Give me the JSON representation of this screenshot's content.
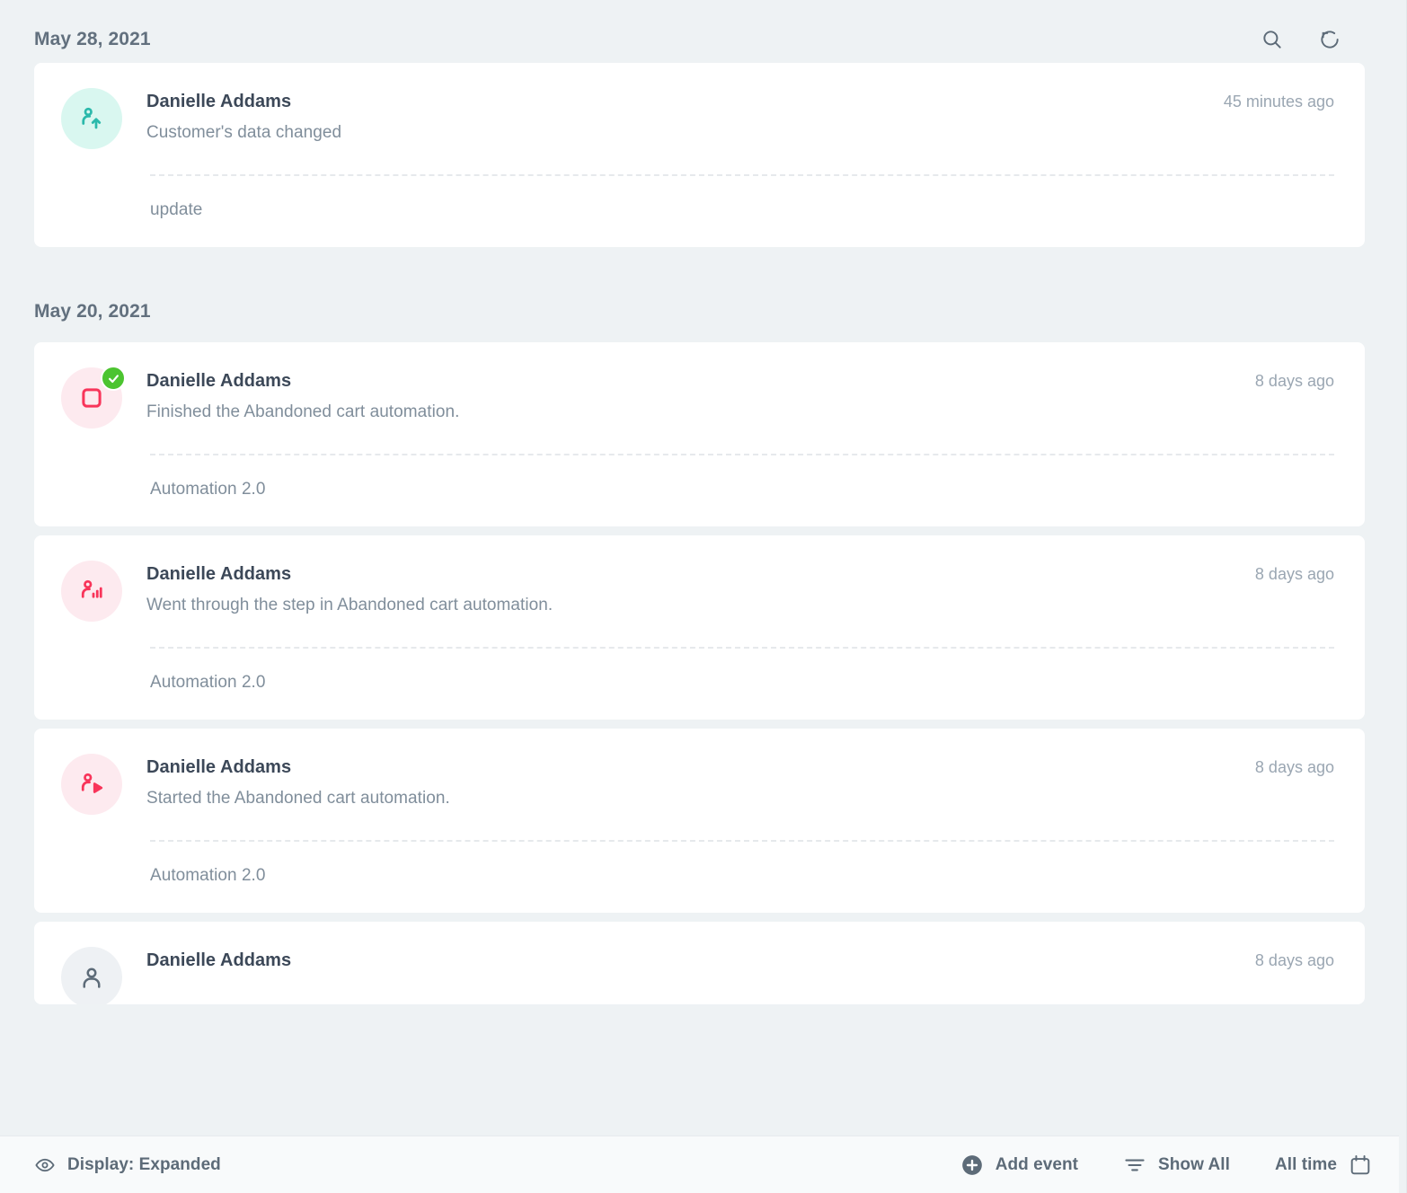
{
  "header": {
    "tools": [
      {
        "name": "search-icon",
        "label": "Search"
      },
      {
        "name": "refresh-icon",
        "label": "Refresh"
      }
    ]
  },
  "groups": [
    {
      "date": "May 28, 2021",
      "events": [
        {
          "name": "Danielle Addams",
          "description": "Customer's data changed",
          "time": "45 minutes ago",
          "detail": "update",
          "icon": "person-upload-icon",
          "avatar_bg": "teal",
          "icon_color": "#2bb9ab",
          "badge": false
        }
      ]
    },
    {
      "date": "May 20, 2021",
      "events": [
        {
          "name": "Danielle Addams",
          "description": "Finished the Abandoned cart automation.",
          "time": "8 days ago",
          "detail": "Automation 2.0",
          "icon": "stop-square-icon",
          "avatar_bg": "pink",
          "icon_color": "#f8355a",
          "badge": true,
          "badge_color": "#4cc430"
        },
        {
          "name": "Danielle Addams",
          "description": "Went through the step in Abandoned cart automation.",
          "time": "8 days ago",
          "detail": "Automation 2.0",
          "icon": "person-chart-icon",
          "avatar_bg": "pink",
          "icon_color": "#f8355a",
          "badge": false
        },
        {
          "name": "Danielle Addams",
          "description": "Started the Abandoned cart automation.",
          "time": "8 days ago",
          "detail": "Automation 2.0",
          "icon": "person-play-icon",
          "avatar_bg": "pink",
          "icon_color": "#f8355a",
          "badge": false
        },
        {
          "name": "Danielle Addams",
          "description": "",
          "time": "8 days ago",
          "detail": "",
          "icon": "person-icon",
          "avatar_bg": "gray",
          "icon_color": "#5d6b78",
          "badge": false,
          "clipped": true
        }
      ]
    }
  ],
  "toolbar": {
    "display_label": "Display: Expanded",
    "add_event_label": "Add event",
    "show_all_label": "Show All",
    "all_time_label": "All time"
  },
  "colors": {
    "page_bg": "#eef2f4",
    "card_bg": "#ffffff",
    "toolbar_bg": "#f8fafb",
    "teal_accent": "#2bb9ab",
    "teal_soft": "#d9f7f0",
    "pink_accent": "#f8355a",
    "pink_soft": "#fdeaef",
    "green_badge": "#4cc430",
    "heading_text": "#3c4858",
    "body_text": "#808e9b",
    "muted_text": "#9aa6b2"
  }
}
